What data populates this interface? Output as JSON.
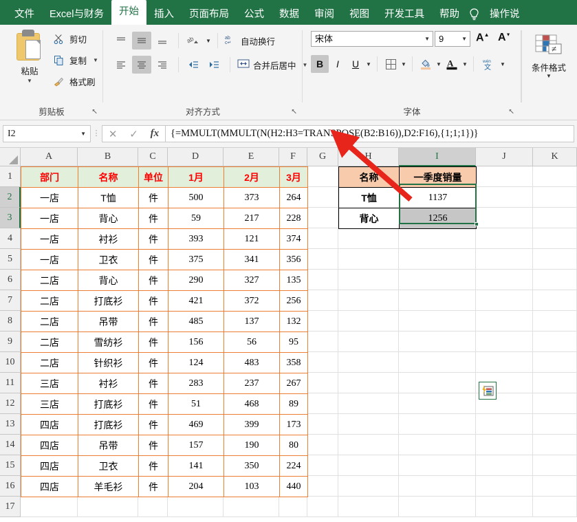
{
  "ribbon": {
    "tabs": [
      {
        "label": "文件",
        "active": false
      },
      {
        "label": "Excel与财务",
        "active": false
      },
      {
        "label": "开始",
        "active": true
      },
      {
        "label": "插入",
        "active": false
      },
      {
        "label": "页面布局",
        "active": false
      },
      {
        "label": "公式",
        "active": false
      },
      {
        "label": "数据",
        "active": false
      },
      {
        "label": "审阅",
        "active": false
      },
      {
        "label": "视图",
        "active": false
      },
      {
        "label": "开发工具",
        "active": false
      },
      {
        "label": "帮助",
        "active": false
      }
    ],
    "tell_me": "操作说",
    "clipboard": {
      "title": "剪贴板",
      "paste": "粘贴",
      "cut": "剪切",
      "copy": "复制",
      "format_painter": "格式刷"
    },
    "alignment": {
      "title": "对齐方式",
      "wrap_text": "自动换行",
      "merge_center": "合并后居中"
    },
    "font": {
      "title": "字体",
      "font_name": "宋体",
      "font_size": "9",
      "bold": "B",
      "italic": "I",
      "underline": "U",
      "phonetic_top": "wén",
      "phonetic_bottom": "文"
    },
    "styles": {
      "conditional_format": "条件格式"
    }
  },
  "formula_bar": {
    "name_box": "I2",
    "cancel": "✕",
    "confirm": "✓",
    "fx": "fx",
    "formula": "{=MMULT(MMULT(N(H2:H3=TRANSPOSE(B2:B16)),D2:F16),{1;1;1})}"
  },
  "sheet": {
    "columns": [
      "A",
      "B",
      "C",
      "D",
      "E",
      "F",
      "G",
      "H",
      "I",
      "J",
      "K"
    ],
    "selected_column": "I",
    "rows": [
      "1",
      "2",
      "3",
      "4",
      "5",
      "6",
      "7",
      "8",
      "9",
      "10",
      "11",
      "12",
      "13",
      "14",
      "15",
      "16",
      "17"
    ],
    "active_rows": [
      "2",
      "3"
    ],
    "table": {
      "headers": [
        "部门",
        "名称",
        "单位",
        "1月",
        "2月",
        "3月"
      ],
      "rows": [
        [
          "一店",
          "T恤",
          "件",
          "500",
          "373",
          "264"
        ],
        [
          "一店",
          "背心",
          "件",
          "59",
          "217",
          "228"
        ],
        [
          "一店",
          "衬衫",
          "件",
          "393",
          "121",
          "374"
        ],
        [
          "一店",
          "卫衣",
          "件",
          "375",
          "341",
          "356"
        ],
        [
          "二店",
          "背心",
          "件",
          "290",
          "327",
          "135"
        ],
        [
          "二店",
          "打底衫",
          "件",
          "421",
          "372",
          "256"
        ],
        [
          "二店",
          "吊带",
          "件",
          "485",
          "137",
          "132"
        ],
        [
          "二店",
          "雪纺衫",
          "件",
          "156",
          "56",
          "95"
        ],
        [
          "二店",
          "针织衫",
          "件",
          "124",
          "483",
          "358"
        ],
        [
          "三店",
          "衬衫",
          "件",
          "283",
          "237",
          "267"
        ],
        [
          "三店",
          "打底衫",
          "件",
          "51",
          "468",
          "89"
        ],
        [
          "四店",
          "打底衫",
          "件",
          "469",
          "399",
          "173"
        ],
        [
          "四店",
          "吊带",
          "件",
          "157",
          "190",
          "80"
        ],
        [
          "四店",
          "卫衣",
          "件",
          "141",
          "350",
          "224"
        ],
        [
          "四店",
          "羊毛衫",
          "件",
          "204",
          "103",
          "440"
        ]
      ]
    },
    "result": {
      "headers": [
        "名称",
        "一季度销量"
      ],
      "rows": [
        [
          "T恤",
          "1137"
        ],
        [
          "背心",
          "1256"
        ]
      ]
    }
  },
  "colors": {
    "ribbon_green": "#217346",
    "table_border": "#ED7D31",
    "table_header_fill": "#E2EFDA",
    "table_header_text": "#FF0000",
    "result_header_fill": "#F8CBAD",
    "selection_green": "#217346",
    "annotation_red": "#E8251B"
  }
}
